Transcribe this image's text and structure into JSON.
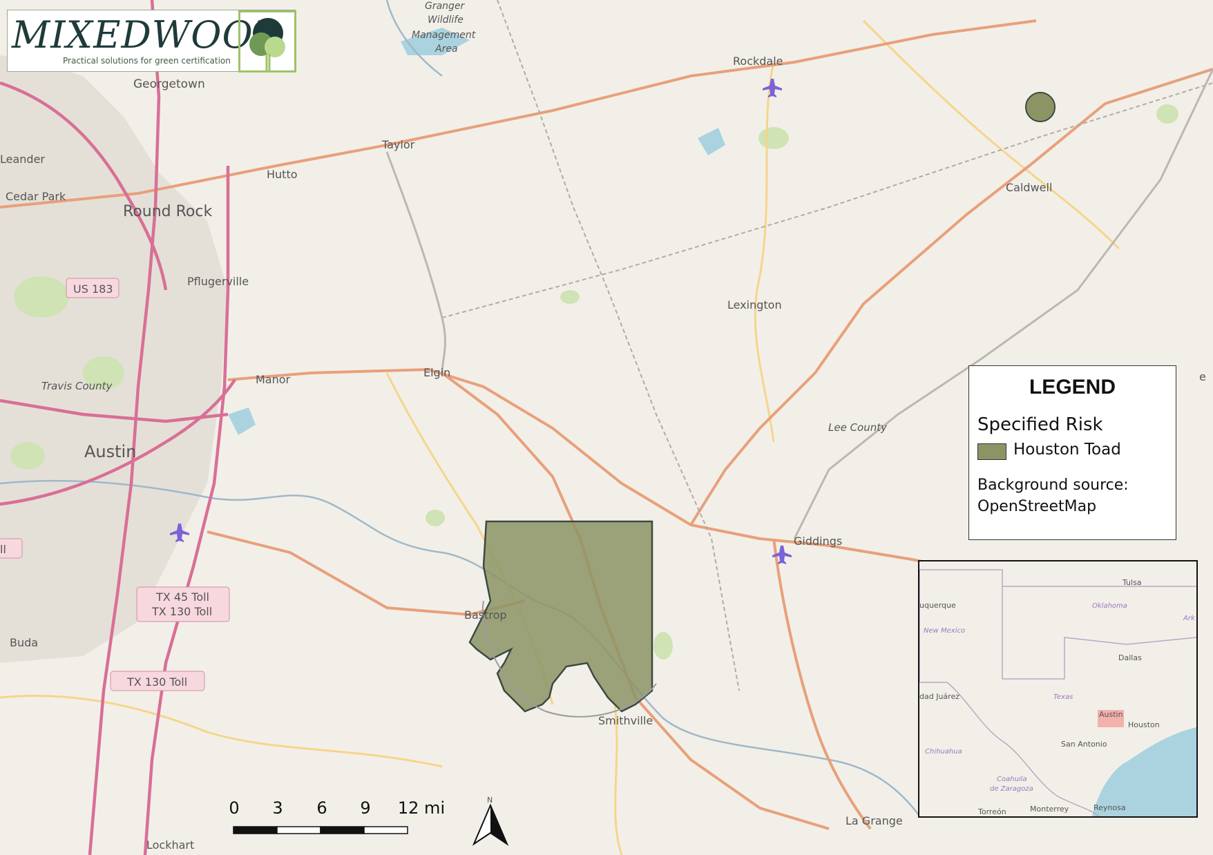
{
  "logo": {
    "name": "MIXEDWOOD",
    "tagline": "Practical solutions for green certification"
  },
  "legend": {
    "title": "LEGEND",
    "subtitle": "Specified Risk",
    "item": "Houston Toad",
    "item_color": "#8c9466",
    "source_line1": "Background source:",
    "source_line2": "OpenStreetMap"
  },
  "places": {
    "georgetown": "Georgetown",
    "leander": "Leander",
    "cedar_park": "Cedar Park",
    "round_rock": "Round Rock",
    "hutto": "Hutto",
    "taylor": "Taylor",
    "pflugerville": "Pflugerville",
    "manor": "Manor",
    "austin": "Austin",
    "travis_county": "Travis County",
    "buda": "Buda",
    "lockhart": "Lockhart",
    "elgin": "Elgin",
    "bastrop": "Bastrop",
    "smithville": "Smithville",
    "rockdale": "Rockdale",
    "lexington": "Lexington",
    "giddings": "Giddings",
    "lee_county": "Lee County",
    "caldwell": "Caldwell",
    "la_grange": "La Grange",
    "granger_1": "Granger",
    "granger_2": "Wildlife",
    "granger_3": "Management",
    "granger_4": "Area"
  },
  "shields": {
    "us183": "US 183",
    "tx45_1": "TX 45 Toll",
    "tx45_2": "TX 130 Toll",
    "tx130": "TX 130 Toll",
    "edge_left": "ll"
  },
  "inset": {
    "tulsa": "Tulsa",
    "albuquerque": "uquerque",
    "oklahoma": "Oklahoma",
    "ark": "Ark",
    "new_mexico": "New Mexico",
    "dallas": "Dallas",
    "juarez": "dad Juárez",
    "texas": "Texas",
    "austin": "Austin",
    "houston": "Houston",
    "san_antonio": "San Antonio",
    "chihuahua": "Chihuahua",
    "coahuila_1": "Coahuila",
    "coahuila_2": "de Zaragoza",
    "torreon": "Torreón",
    "monterrey": "Monterrey",
    "reynosa": "Reynosa"
  },
  "scale": {
    "ticks": [
      "0",
      "3",
      "6",
      "9",
      "12 mi"
    ]
  },
  "north_label": "N",
  "edge_letter": "e",
  "colors": {
    "major_road": "#e8a07a",
    "secondary_road": "#f6d58a",
    "highway": "#d96f96",
    "river": "#9fb8c8",
    "risk_fill": "#8c9466",
    "inset_highlight": "#f2a6a0",
    "water": "#aad3df"
  }
}
